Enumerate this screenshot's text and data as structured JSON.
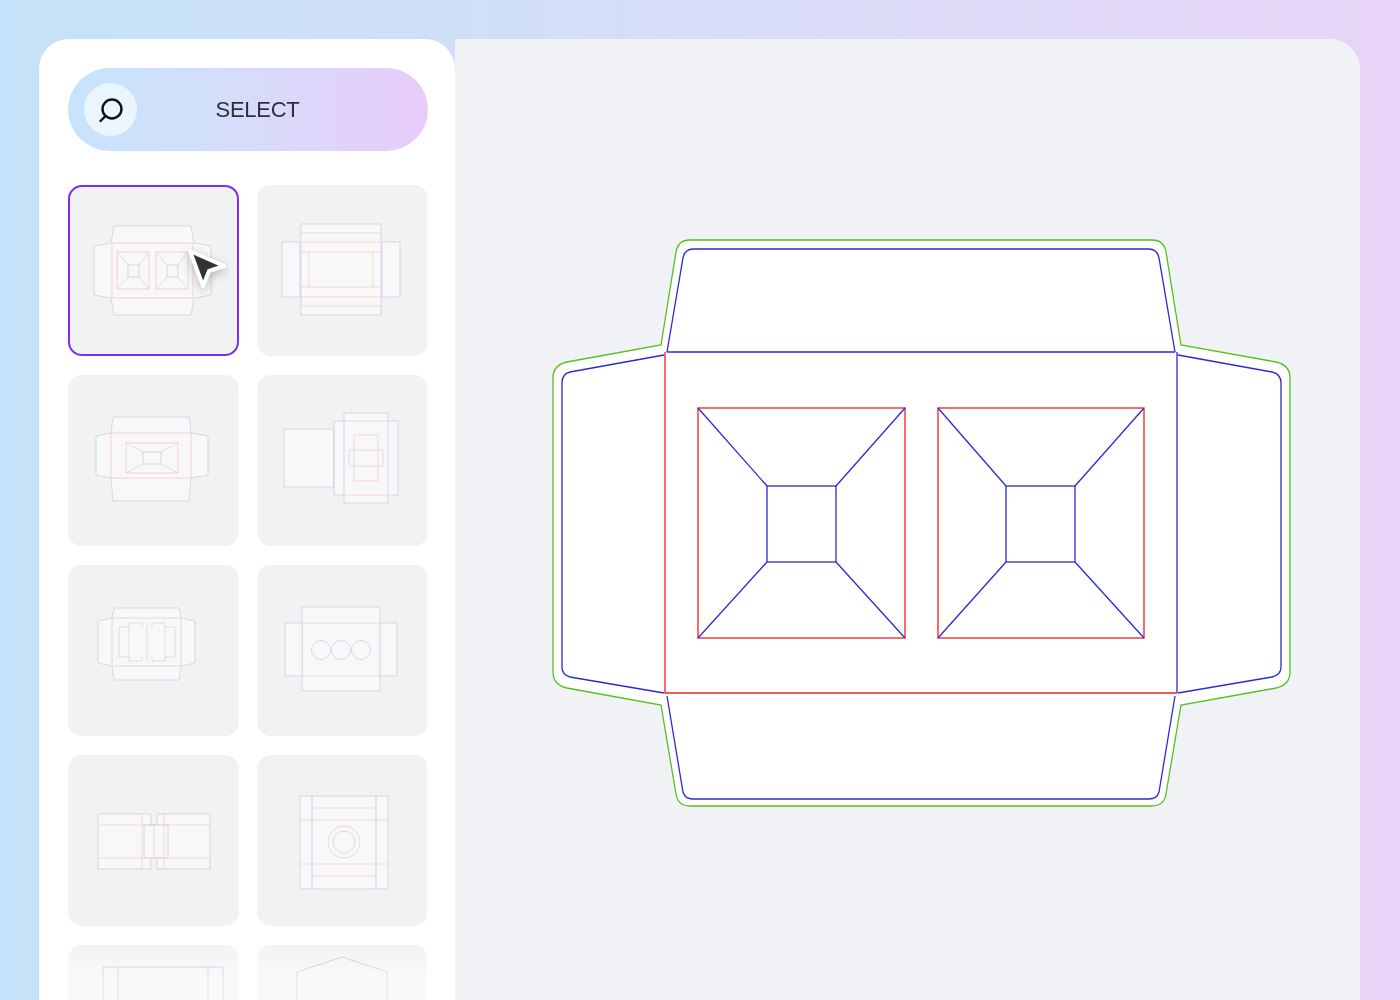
{
  "select_button": {
    "label": "SELECT"
  },
  "templates": [
    {
      "kind": "twocell",
      "selected": true
    },
    {
      "kind": "sleeve",
      "selected": false
    },
    {
      "kind": "pyramid",
      "selected": false
    },
    {
      "kind": "tuckend",
      "selected": false
    },
    {
      "kind": "insert",
      "selected": false
    },
    {
      "kind": "triple",
      "selected": false
    },
    {
      "kind": "wrap",
      "selected": false
    },
    {
      "kind": "ring",
      "selected": false
    },
    {
      "kind": "fold",
      "selected": false
    },
    {
      "kind": "peak",
      "selected": false
    }
  ]
}
